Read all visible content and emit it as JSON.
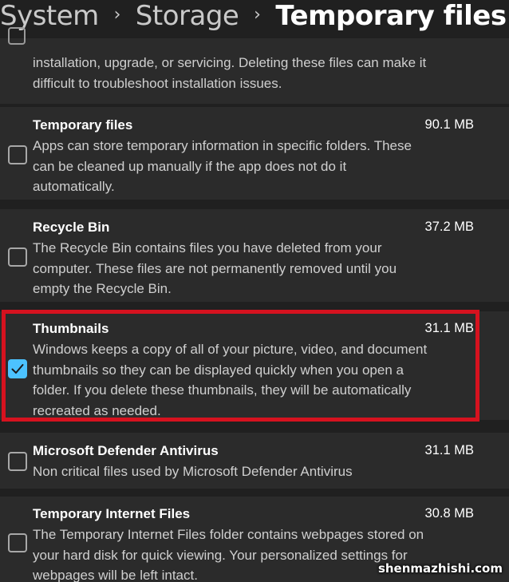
{
  "breadcrumb": {
    "items": [
      "System",
      "Storage",
      "Temporary files"
    ]
  },
  "items": [
    {
      "title": "",
      "size": "",
      "checked": false,
      "description_lines": [
        "installation, upgrade, or servicing.  Deleting these files can make it",
        "difficult to troubleshoot installation issues."
      ]
    },
    {
      "title": "Temporary files",
      "size": "90.1 MB",
      "checked": false,
      "description_lines": [
        "Apps can store temporary information in specific folders. These",
        "can be cleaned up manually if the app does not do it",
        "automatically."
      ]
    },
    {
      "title": "Recycle Bin",
      "size": "37.2 MB",
      "checked": false,
      "description_lines": [
        "The Recycle Bin contains files you have deleted from your",
        "computer. These files are not permanently removed until you",
        "empty the Recycle Bin."
      ]
    },
    {
      "title": "Thumbnails",
      "size": "31.1 MB",
      "checked": true,
      "description_lines": [
        "Windows keeps a copy of all of your picture, video, and document",
        "thumbnails so they can be displayed quickly when you open a",
        "folder. If you delete these thumbnails, they will be automatically",
        "recreated as needed."
      ]
    },
    {
      "title": "Microsoft Defender Antivirus",
      "size": "31.1 MB",
      "checked": false,
      "description_lines": [
        "Non critical files used by Microsoft Defender Antivirus"
      ]
    },
    {
      "title": "Temporary Internet Files",
      "size": "30.8 MB",
      "checked": false,
      "description_lines": [
        "The Temporary Internet Files folder contains webpages stored on",
        "your hard disk for quick viewing. Your personalized settings for",
        "webpages will be left intact."
      ]
    }
  ],
  "watermark": "shenmazhishi.com",
  "colors": {
    "background": "#202020",
    "card": "#2b2b2b",
    "accent": "#4cc2ff",
    "highlight": "#d6121f"
  },
  "icons": {
    "breadcrumb_separator": "chevron-right-icon",
    "checkmark": "checkmark-icon"
  }
}
